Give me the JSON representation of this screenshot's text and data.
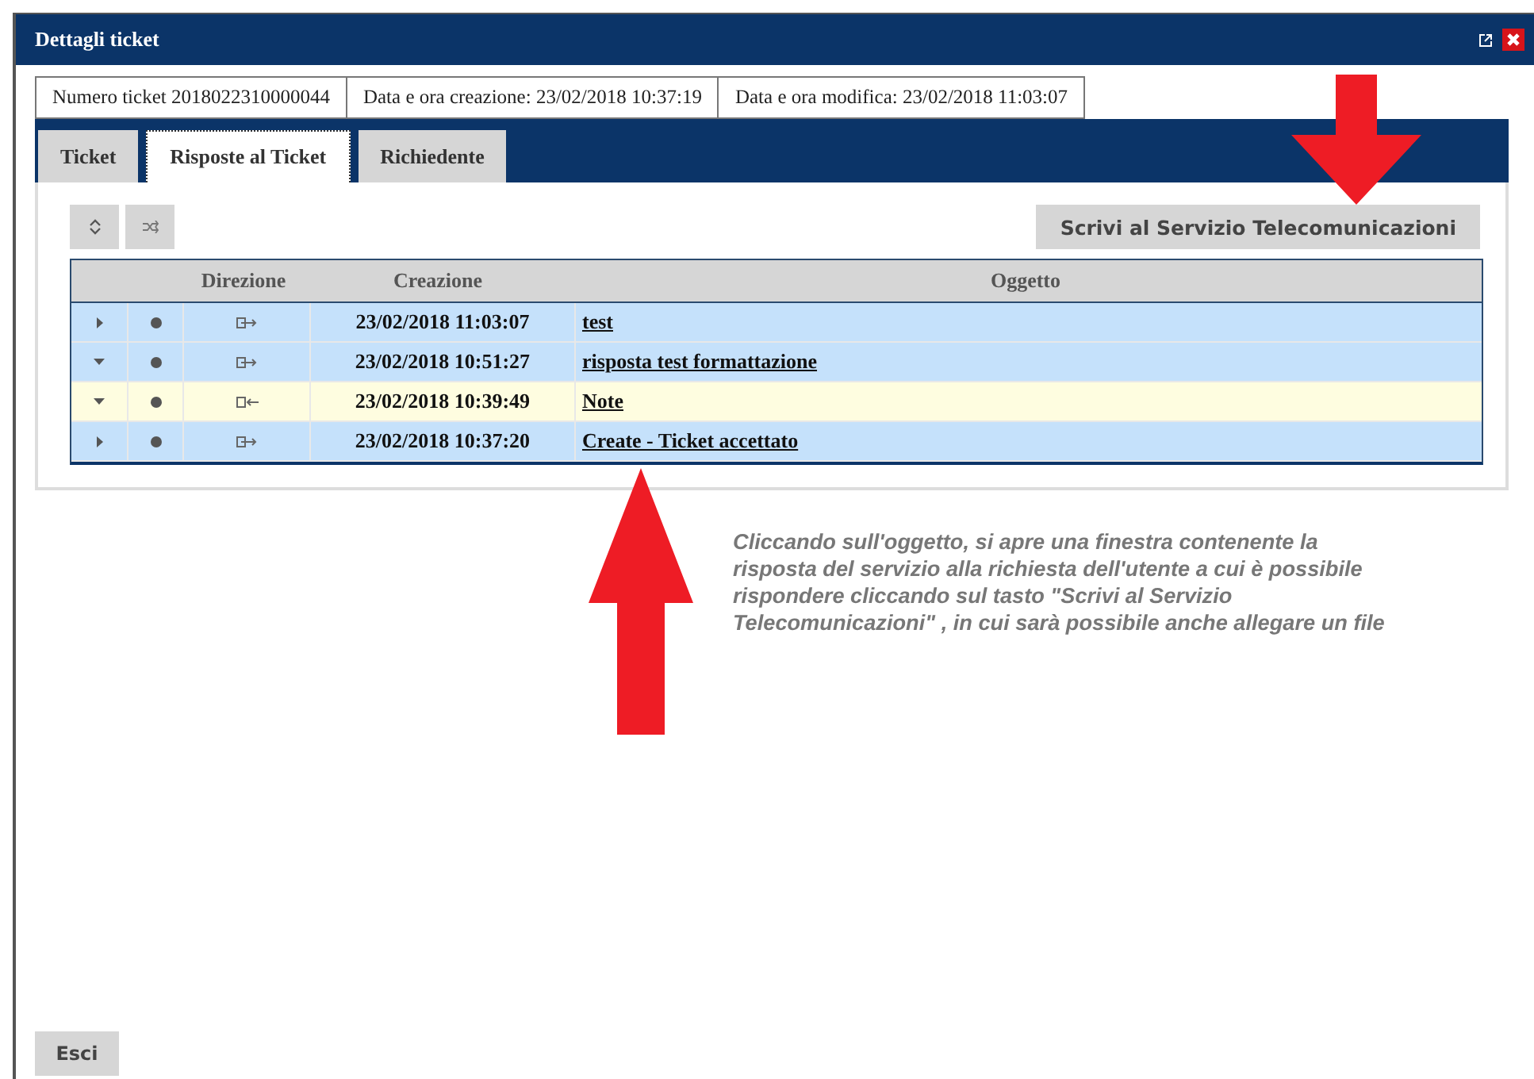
{
  "window": {
    "title": "Dettagli ticket"
  },
  "info": [
    {
      "label": "Numero ticket",
      "value": "2018022310000044"
    },
    {
      "label": "Data e ora creazione:",
      "value": "23/02/2018 10:37:19"
    },
    {
      "label": "Data e ora modifica:",
      "value": "23/02/2018 11:03:07"
    }
  ],
  "tabs": [
    {
      "label": "Ticket",
      "selected": false
    },
    {
      "label": "Risposte al Ticket",
      "selected": true
    },
    {
      "label": "Richiedente",
      "selected": false
    }
  ],
  "write_button": "Scrivi al Servizio Telecomunicazioni",
  "table": {
    "columns": [
      "Direzione",
      "Creazione",
      "Oggetto"
    ],
    "rows": [
      {
        "expanded": false,
        "kind": "outgoing",
        "created": "23/02/2018 11:03:07",
        "subject": "test",
        "selected": false
      },
      {
        "expanded": true,
        "kind": "outgoing",
        "created": "23/02/2018 10:51:27",
        "subject": "risposta test formattazione",
        "selected": false
      },
      {
        "expanded": true,
        "kind": "incoming",
        "created": "23/02/2018 10:39:49",
        "subject": "Note",
        "selected": true
      },
      {
        "expanded": false,
        "kind": "outgoing",
        "created": "23/02/2018 10:37:20",
        "subject": "Create - Ticket accettato",
        "selected": false
      }
    ]
  },
  "annotation": "Cliccando sull'oggetto, si apre una finestra contenente la risposta del servizio alla richiesta dell'utente a cui è possibile rispondere cliccando sul tasto \"Scrivi al Servizio Telecomunicazioni\" , in cui sarà possibile anche allegare un file",
  "exit_button": "Esci"
}
